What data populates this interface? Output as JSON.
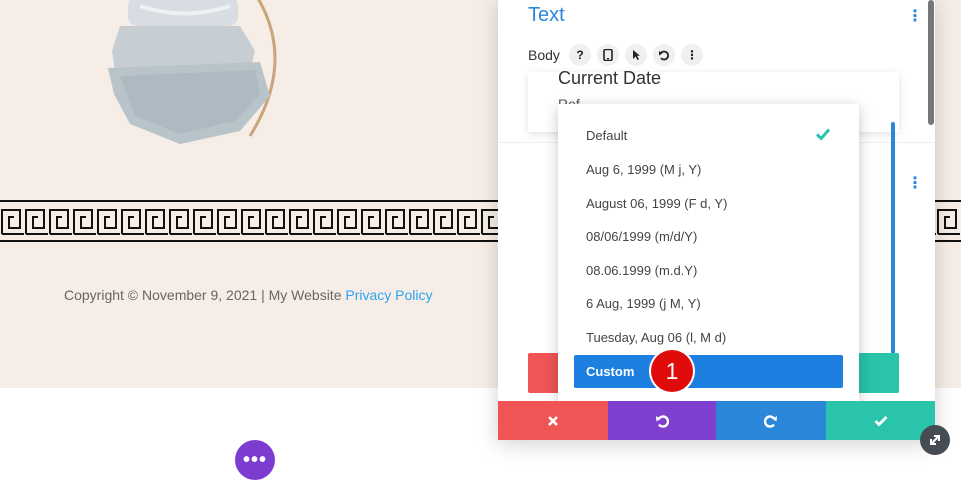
{
  "footer": {
    "copyright_text": "Copyright © November 9, 2021 | My Website",
    "privacy_link": "Privacy Policy",
    "link_color": "#2ea3f2"
  },
  "panel": {
    "title": "Text",
    "body_label": "Body",
    "toolbar_icons": [
      "help-icon",
      "mobile-icon",
      "cursor-icon",
      "undo-icon",
      "more-icon"
    ],
    "help_glyph": "?",
    "field": {
      "label": "Current Date",
      "sub_label": "Ref"
    }
  },
  "dropdown": {
    "options": [
      {
        "label": "Default",
        "selected": true
      },
      {
        "label": "Aug 6, 1999 (M j, Y)"
      },
      {
        "label": "August 06, 1999 (F d, Y)"
      },
      {
        "label": "08/06/1999 (m/d/Y)"
      },
      {
        "label": "08.06.1999 (m.d.Y)"
      },
      {
        "label": "6 Aug, 1999 (j M, Y)"
      },
      {
        "label": "Tuesday, Aug 06 (l, M d)"
      }
    ],
    "highlighted": "Custom"
  },
  "annotation": {
    "step": "1"
  },
  "actions": {
    "cancel": "✖",
    "undo": "↺",
    "redo": "↻",
    "save": "✔"
  },
  "colors": {
    "accent": "#2b87da",
    "cancel": "#ef5555",
    "undo": "#7f3fcf",
    "save": "#29c4a9",
    "page_bg": "#f5ede6"
  }
}
